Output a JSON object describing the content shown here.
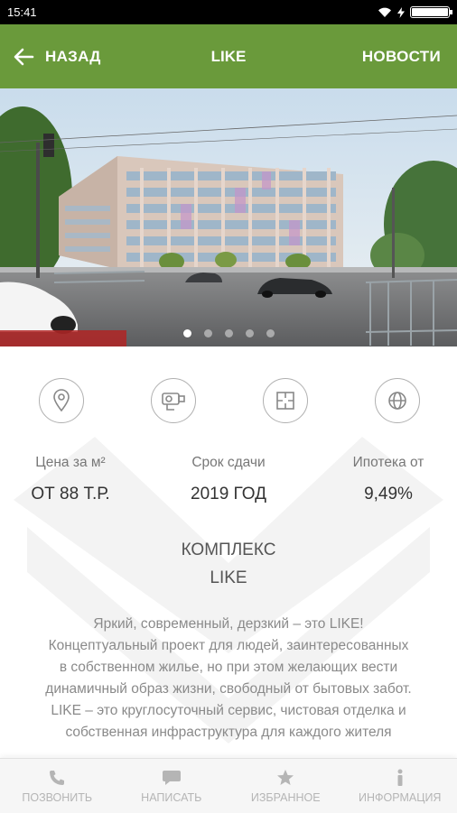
{
  "status_bar": {
    "time": "15:41",
    "battery_level": 1.0
  },
  "app_bar": {
    "back_label": "НАЗАД",
    "title": "LIKE",
    "news_label": "НОВОСТИ",
    "color": "#6a9a3b"
  },
  "carousel": {
    "slide_count": 5,
    "active_index": 0
  },
  "stats": [
    {
      "icon": "location-pin-icon",
      "label": "Цена за м²",
      "value": "ОТ 88 Т.Р."
    },
    {
      "icon": "crane-icon",
      "label": "Срок сдачи",
      "value": "2019 ГОД"
    },
    {
      "icon": "floor-plan-icon",
      "label": "Ипотека от",
      "value": "9,49%"
    },
    {
      "icon": "globe-icon",
      "label": "",
      "value": ""
    }
  ],
  "complex": {
    "heading_line1": "КОМПЛЕКС",
    "heading_line2": "LIKE",
    "description": "Яркий, современный, дерзкий – это LIKE! Концептуальный проект для людей, заинтересованных в собственном жилье, но при этом желающих вести динамичный образ жизни, свободный от бытовых забот. LIKE – это круглосуточный сервис, чистовая отделка и собственная инфраструктура для каждого жителя"
  },
  "bottom_nav": [
    {
      "label": "ПОЗВОНИТЬ",
      "icon": "phone-icon"
    },
    {
      "label": "НАПИСАТЬ",
      "icon": "chat-icon"
    },
    {
      "label": "ИЗБРАННОЕ",
      "icon": "star-icon"
    },
    {
      "label": "ИНФОРМАЦИЯ",
      "icon": "info-icon"
    }
  ]
}
